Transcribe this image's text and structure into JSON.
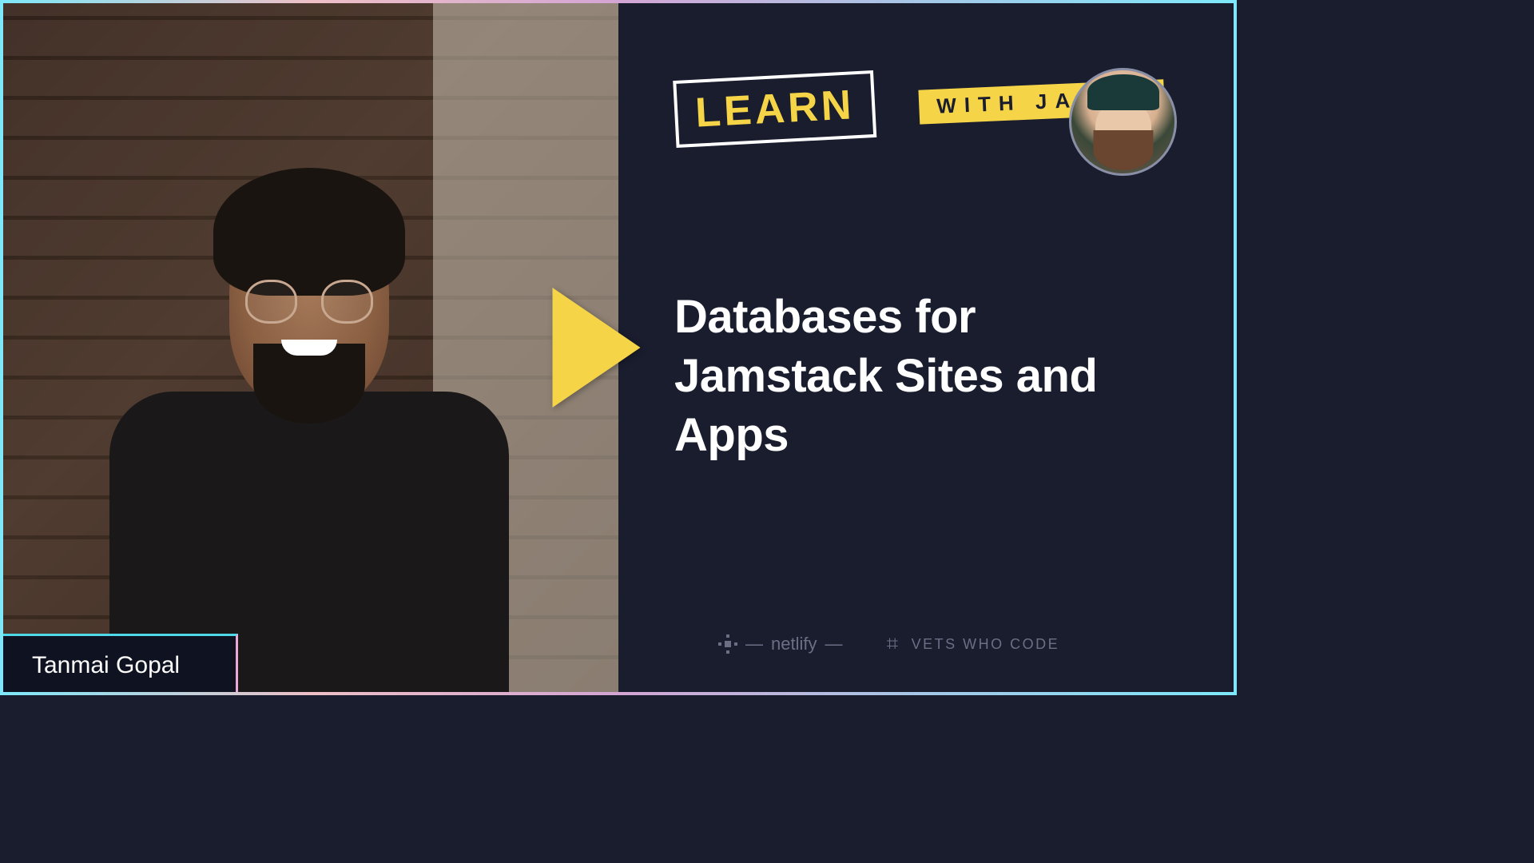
{
  "show": {
    "logo_main": "LEARN",
    "logo_sub": "WITH JASON"
  },
  "episode": {
    "title": "Databases for Jamstack Sites and Apps"
  },
  "guest": {
    "name": "Tanmai Gopal"
  },
  "sponsors": {
    "netlify": "netlify",
    "vets": "VETS WHO CODE"
  }
}
